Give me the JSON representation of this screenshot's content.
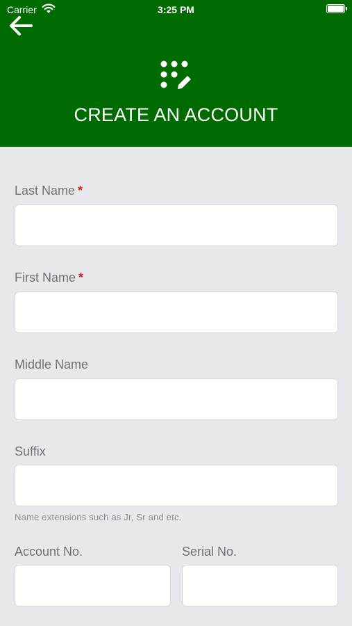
{
  "status_bar": {
    "carrier": "Carrier",
    "time": "3:25 PM"
  },
  "header": {
    "title": "CREATE AN ACCOUNT",
    "background": "#006b00"
  },
  "form": {
    "last_name": {
      "label": "Last Name",
      "required": "*",
      "value": ""
    },
    "first_name": {
      "label": "First Name",
      "required": "*",
      "value": ""
    },
    "middle_name": {
      "label": "Middle Name",
      "value": ""
    },
    "suffix": {
      "label": "Suffix",
      "value": "",
      "hint": "Name extensions such as Jr, Sr and etc."
    },
    "account_no": {
      "label": "Account No.",
      "value": ""
    },
    "serial_no": {
      "label": "Serial No.",
      "value": ""
    }
  },
  "colors": {
    "required": "#d42020",
    "page_bg": "#e6e8ec"
  }
}
